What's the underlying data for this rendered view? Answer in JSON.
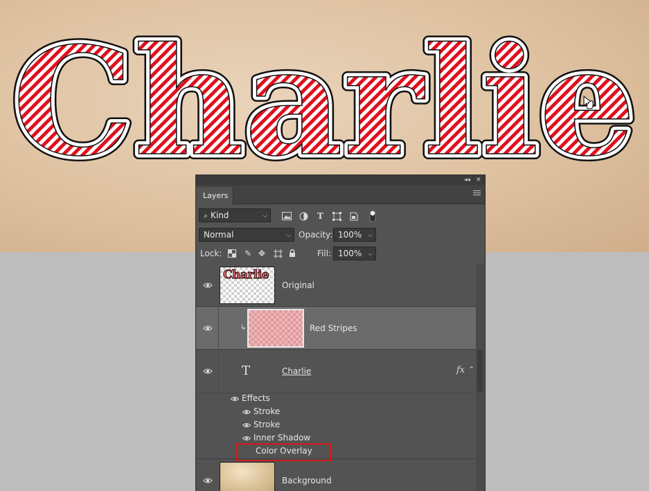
{
  "canvas": {
    "title_text": "Charlie",
    "colors": {
      "background": "#dec1a0",
      "stripe_red": "#e0101e",
      "stroke_outer": "#111111",
      "fill_white": "#ffffff",
      "below_canvas": "#bdbdbd"
    }
  },
  "panel": {
    "tab_label": "Layers",
    "filter": {
      "label": "Kind",
      "icons": [
        "image-filter-icon",
        "adjustment-filter-icon",
        "type-filter-icon",
        "shape-filter-icon",
        "smart-object-filter-icon",
        "filter-toggle-icon"
      ]
    },
    "blend_mode": "Normal",
    "opacity_label": "Opacity:",
    "opacity_value": "100%",
    "lock_label": "Lock:",
    "fill_label": "Fill:",
    "fill_value": "100%",
    "layers": [
      {
        "name": "Original",
        "thumb_text": "Charlie",
        "type": "image"
      },
      {
        "name": "Red Stripes",
        "type": "smart-clipped",
        "selected": true
      },
      {
        "name": "Charlie",
        "type": "text",
        "fx": "fx"
      },
      {
        "name": "Background",
        "type": "image"
      }
    ],
    "effects": {
      "label": "Effects",
      "items": [
        "Stroke",
        "Stroke",
        "Inner Shadow",
        "Color Overlay"
      ]
    },
    "text_layer_icon": "T",
    "highlight_color": "#d4181e"
  }
}
